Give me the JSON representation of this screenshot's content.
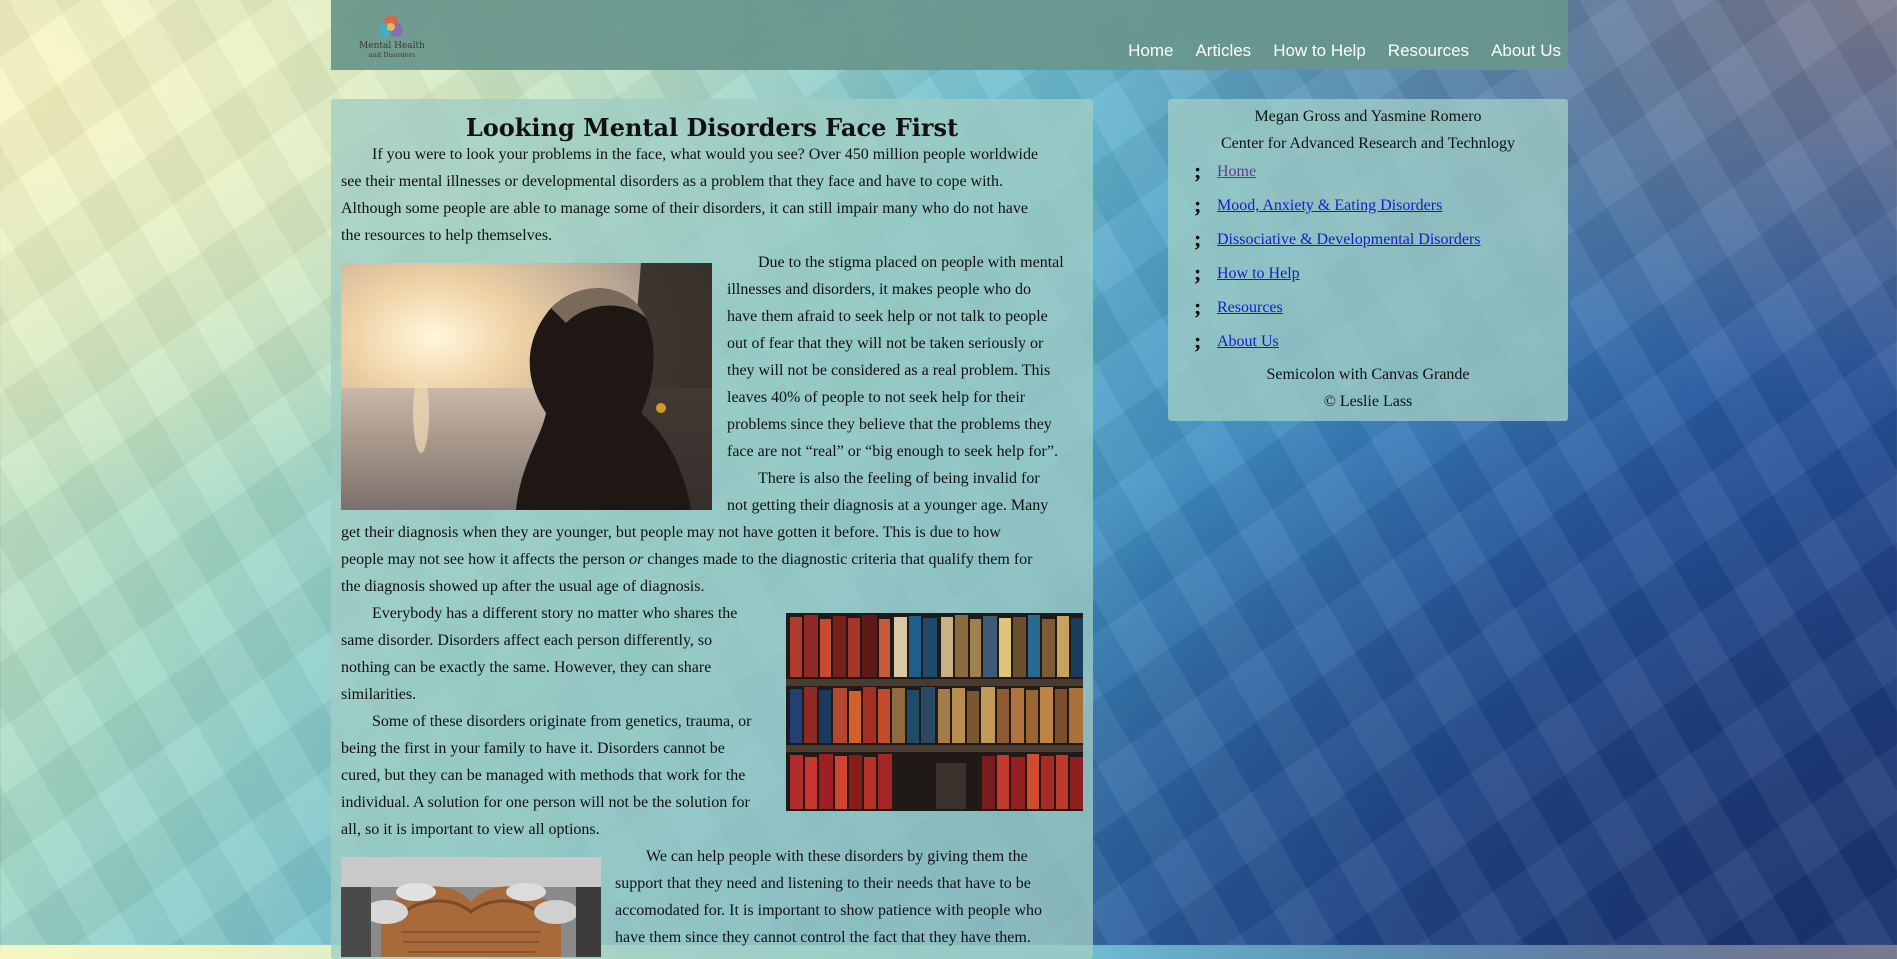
{
  "header": {
    "logo": {
      "title": "Mental Health",
      "subtitle": "and Disorders"
    },
    "nav": [
      "Home",
      "Articles",
      "How to Help",
      "Resources",
      "About Us"
    ]
  },
  "article": {
    "title": "Looking Mental Disorders Face First",
    "p1_lines": [
      "If you were to look your problems in the face, what would you see? Over 450 million people worldwide",
      "see their mental illnesses or developmental disorders as a problem that they face and have to cope with.",
      "Although some people are able to manage some of their disorders, it can still impair many who do not have",
      "the resources to help themselves."
    ],
    "p2_lines": [
      "Due to the stigma placed on people with mental",
      "illnesses and disorders, it makes people who do",
      "have them afraid to seek help or not talk to people",
      "out of fear that they will not be taken seriously or",
      "they will not be considered as a real problem. This",
      "leaves 40% of people to not seek help for their",
      "problems since they believe that the problems they",
      "face are not “real” or “big enough to seek help for”."
    ],
    "p3_wrap_lines": [
      "There is also the feeling of being invalid for",
      "not getting their diagnosis at a younger age. Many"
    ],
    "p3_full_lines": [
      "get their diagnosis when they are younger, but people may not have gotten it before. This is due to how",
      "the diagnosis showed up after the usual age of diagnosis."
    ],
    "p3_line4": {
      "before": "people may not see how it affects the person",
      "em": "or",
      "after": "changes made to the diagnostic criteria that qualify them for"
    },
    "p4_lines": [
      "Everybody has a different story no matter who shares the",
      "same disorder. Disorders affect each person differently, so",
      "nothing can be exactly the same. However, they can share",
      "similarities."
    ],
    "p5_lines": [
      "Some of these disorders originate from genetics, trauma, or",
      "being the first in your family to have it. Disorders cannot be",
      "cured, but they can be managed with methods that work for the",
      "individual. A solution for one person will not be the solution for",
      "all, so it is important to view all options."
    ],
    "p6_lines": [
      "We can help people with these disorders by giving them the",
      "support that they need and listening to their needs that have to be",
      "accomodated for. It is important to show patience with people who",
      "have them since they cannot control the fact that they have them."
    ]
  },
  "sidebar": {
    "authors": "Megan Gross and Yasmine Romero",
    "center": "Center for Advanced Research and Technlogy",
    "links": [
      "Home",
      "Mood, Anxiety & Eating Disorders",
      "Dissociative & Developmental Disorders",
      "How to Help",
      "Resources",
      "About Us"
    ],
    "bullet_glyph": ";",
    "footer_line1": "Semicolon with Canvas Grande",
    "footer_line2": "© Leslie Lass"
  },
  "colors": {
    "header_bg": "#68968c",
    "panel_bg": "#a0cdc4",
    "link": "#1a1acb",
    "visited_link": "#5c3e8e"
  }
}
